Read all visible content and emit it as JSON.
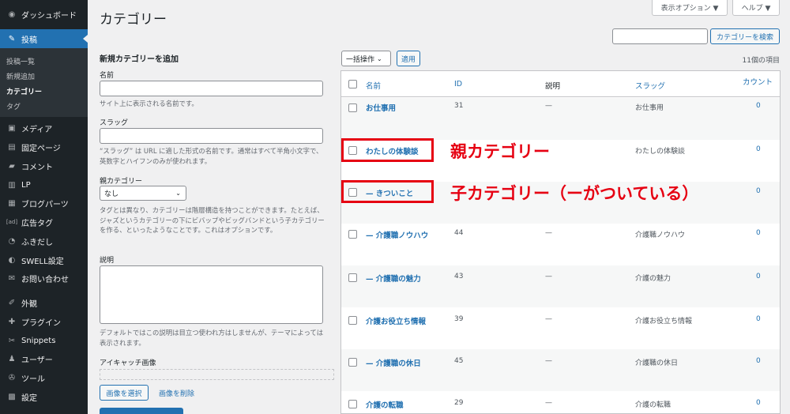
{
  "sidebar": {
    "items": [
      {
        "icon": "dashboard-icon",
        "glyph": "◉",
        "label": "ダッシュボード"
      },
      {
        "icon": "pin-icon",
        "glyph": "✎",
        "label": "投稿"
      },
      {
        "icon": "media-icon",
        "glyph": "▣",
        "label": "メディア"
      },
      {
        "icon": "page-icon",
        "glyph": "▤",
        "label": "固定ページ"
      },
      {
        "icon": "comment-icon",
        "glyph": "▰",
        "label": "コメント"
      },
      {
        "icon": "lp-icon",
        "glyph": "▥",
        "label": "LP"
      },
      {
        "icon": "blockparts-icon",
        "glyph": "▦",
        "label": "ブログパーツ"
      },
      {
        "icon": "ad-icon",
        "glyph": "[ad]",
        "label": "広告タグ"
      },
      {
        "icon": "speech-bubble-icon",
        "glyph": "◔",
        "label": "ふきだし"
      },
      {
        "icon": "swell-icon",
        "glyph": "◐",
        "label": "SWELL設定"
      },
      {
        "icon": "mail-icon",
        "glyph": "✉",
        "label": "お問い合わせ"
      },
      {
        "icon": "brush-icon",
        "glyph": "✐",
        "label": "外観"
      },
      {
        "icon": "plugin-icon",
        "glyph": "✚",
        "label": "プラグイン"
      },
      {
        "icon": "snippets-icon",
        "glyph": "✂",
        "label": "Snippets"
      },
      {
        "icon": "user-icon",
        "glyph": "♟",
        "label": "ユーザー"
      },
      {
        "icon": "wrench-icon",
        "glyph": "✇",
        "label": "ツール"
      },
      {
        "icon": "settings-icon",
        "glyph": "▩",
        "label": "設定"
      }
    ],
    "submenu": [
      "投稿一覧",
      "新規追加",
      "カテゴリー",
      "タグ"
    ]
  },
  "top_buttons": {
    "screen_options": "表示オプション ▼",
    "help": "ヘルプ ▼"
  },
  "page_title": "カテゴリー",
  "form": {
    "heading": "新規カテゴリーを追加",
    "name_label": "名前",
    "name_help": "サイト上に表示される名前です。",
    "slug_label": "スラッグ",
    "slug_help": "“スラッグ” は URL に適した形式の名前です。通常はすべて半角小文字で、英数字とハイフンのみが使われます。",
    "parent_label": "親カテゴリー",
    "parent_value": "なし",
    "parent_help": "タグとは異なり、カテゴリーは階層構造を持つことができます。たとえば、ジャズというカテゴリーの下にビバップやビッグバンドという子カテゴリーを作る、といったようなことです。これはオプションです。",
    "desc_label": "説明",
    "desc_help": "デフォルトではこの説明は目立つ使われ方はしませんが、テーマによっては表示されます。",
    "eyecatch_label": "アイキャッチ画像",
    "select_image": "画像を選択",
    "remove_image": "画像を削除"
  },
  "search": {
    "button": "カテゴリーを検索"
  },
  "bulk": {
    "select": "一括操作",
    "apply": "適用",
    "count": "11個の項目"
  },
  "table": {
    "headers": {
      "name": "名前",
      "id": "ID",
      "desc": "説明",
      "slug": "スラッグ",
      "count": "カウント"
    },
    "rows": [
      {
        "name": "お仕事用",
        "id": "31",
        "desc": "—",
        "slug": "お仕事用",
        "count": "0"
      },
      {
        "name": "わたしの体験談",
        "id": "",
        "desc": "",
        "slug": "わたしの体験談",
        "count": "0"
      },
      {
        "name": "— きついこと",
        "id": "",
        "desc": "",
        "slug": "",
        "count": "0"
      },
      {
        "name": "— 介護職ノウハウ",
        "id": "44",
        "desc": "—",
        "slug": "介護職ノウハウ",
        "count": "0"
      },
      {
        "name": "— 介護職の魅力",
        "id": "43",
        "desc": "—",
        "slug": "介護の魅力",
        "count": "0"
      },
      {
        "name": "介護お役立ち情報",
        "id": "39",
        "desc": "—",
        "slug": "介護お役立ち情報",
        "count": "0"
      },
      {
        "name": "— 介護職の休日",
        "id": "45",
        "desc": "—",
        "slug": "介護職の休日",
        "count": "0"
      },
      {
        "name": "介護の転職",
        "id": "29",
        "desc": "—",
        "slug": "介護の転職",
        "count": "0"
      }
    ]
  },
  "annotations": {
    "parent": "親カテゴリー",
    "child": "子カテゴリー（ーがついている）"
  },
  "colors": {
    "sidebar": "#1d2327",
    "accent": "#2271b1",
    "annotation": "#e60012"
  }
}
